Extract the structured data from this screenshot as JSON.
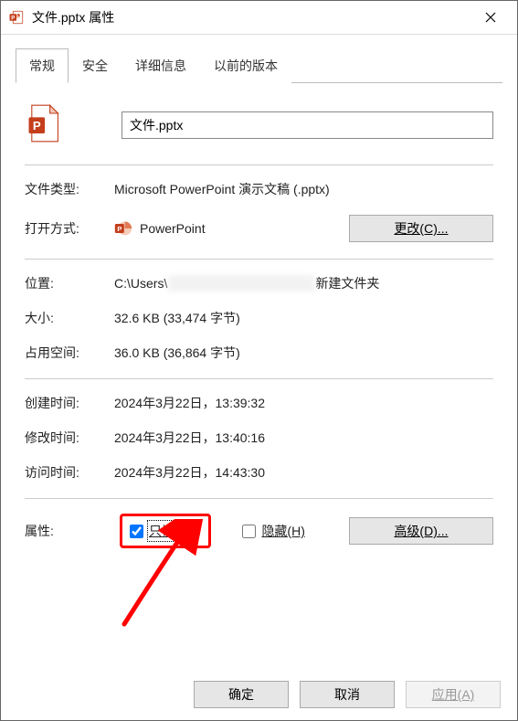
{
  "titlebar": {
    "title": "文件.pptx 属性"
  },
  "tabs": {
    "general": "常规",
    "security": "安全",
    "details": "详细信息",
    "previous": "以前的版本"
  },
  "file": {
    "name": "文件.pptx"
  },
  "labels": {
    "filetype": "文件类型:",
    "openswith": "打开方式:",
    "location": "位置:",
    "size": "大小:",
    "sizeondisk": "占用空间:",
    "created": "创建时间:",
    "modified": "修改时间:",
    "accessed": "访问时间:",
    "attributes": "属性:"
  },
  "values": {
    "filetype": "Microsoft PowerPoint 演示文稿 (.pptx)",
    "openswith_app": "PowerPoint",
    "location_prefix": "C:\\Users\\",
    "location_suffix": "新建文件夹",
    "size": "32.6 KB (33,474 字节)",
    "sizeondisk": "36.0 KB (36,864 字节)",
    "created": "2024年3月22日，13:39:32",
    "modified": "2024年3月22日，13:40:16",
    "accessed": "2024年3月22日，14:43:30"
  },
  "buttons": {
    "change": "更改(C)...",
    "advanced": "高级(D)...",
    "ok": "确定",
    "cancel": "取消",
    "apply": "应用(A)"
  },
  "attributes": {
    "readonly_label": "只读(R)",
    "hidden_label": "隐藏(H)"
  }
}
